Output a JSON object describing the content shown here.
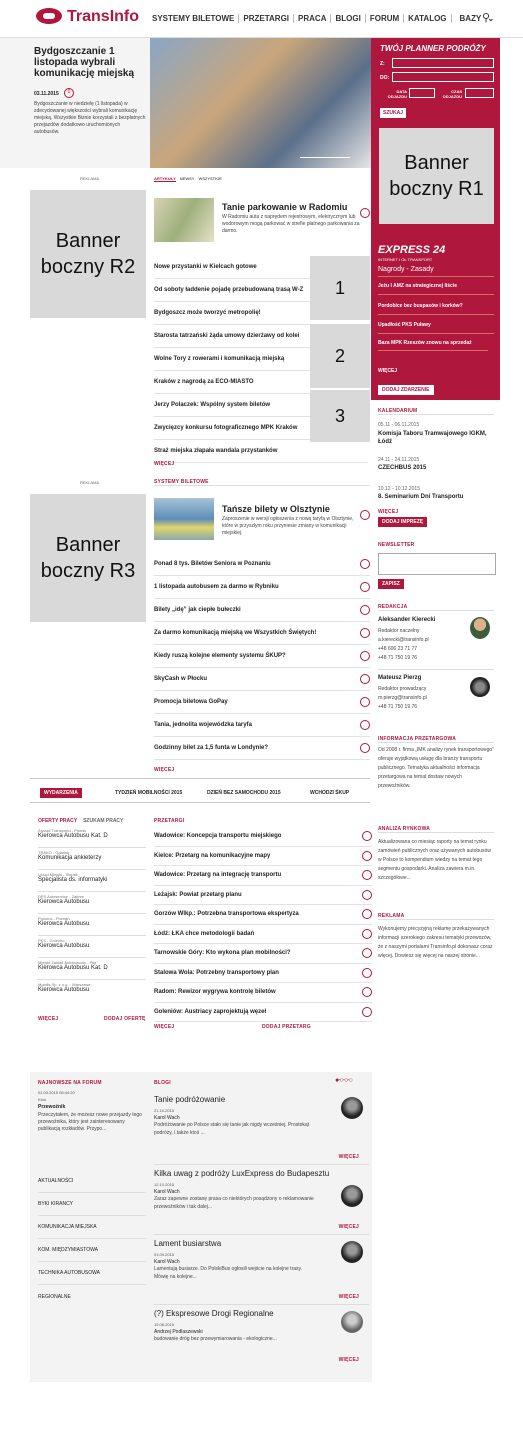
{
  "header": {
    "logo": "TransInfo",
    "nav": [
      "SYSTEMY BILETOWE",
      "PRZETARGI",
      "PRACA",
      "BLOGI",
      "FORUM",
      "KATALOG",
      "BAZY"
    ],
    "search_icon": "search-icon"
  },
  "hero": {
    "title": "Bydgoszczanie 1 listopada wybrali komunikację miejską",
    "date": "03.11.2015",
    "count": "0",
    "text": "Bydgoszczanie w niedzielę (1 listopada) w zdecydowanej większości wybrali komunikację miejską. Wszystkie Biznie korzystali z bezpłatnych przejazdów dodatkowo uruchomionych autobusów."
  },
  "planner": {
    "title": "TWÓJ PLANNER PODRÓŻY",
    "from": "Z:",
    "to": "DO:",
    "date": "DATA ODJAZDU",
    "time": "CZAS ODJAZDU",
    "button": "SZUKAJ"
  },
  "banners": {
    "r1": "Banner boczny R1",
    "r2": "Banner boczny R2",
    "r3": "Banner boczny R3",
    "ad": "REKLAMA"
  },
  "news": {
    "tabs": [
      "ARTYKUŁY",
      "NEWSY",
      "WSZYSTKIE"
    ],
    "feature_title": "Tanie parkowanie w Radomiu",
    "feature_text": "W Radomiu auta z naprędem rejestrowym, elektrycznym lub wodorowym mogą parkować w strefie płatnego parkowania za darmo.",
    "items": [
      "Nowe przystanki w Kielcach gotowe",
      "Od soboty ładdenie pojadę przebudowaną trasą W-Z",
      "Bydgoszcz może tworzyć metropolię!",
      "Starosta tatrzański żąda umowy dzierżawy od kolei",
      "Wolne Tory z rowerami i komunikacją miejską",
      "Kraków z nagrodą za ECO-MIASTO",
      "Jerzy Polaczek: Wspólny system biletów",
      "Zwycięzcy konkursu fotograficznego MPK Kraków",
      "Straż miejska złapała wandala przystanków"
    ],
    "more": "WIĘCEJ",
    "numbers": [
      "1",
      "2",
      "3"
    ]
  },
  "express": {
    "title": "EXPRESS 24",
    "sub": "INTERNET I OŁ TRANSPORT",
    "items": [
      "Nagrody - Zasady",
      "Jeżu I AMZ na strategicznej liście",
      "Pordobice bez buspasów i korków?",
      "Upadłość PKS Puławy",
      "Baza MPK Rzeszów znowu na sprzedaż"
    ],
    "more": "WIĘCEJ",
    "add": "DODAJ ZDARZENIE"
  },
  "calendar": {
    "title": "KALENDARIUM",
    "events": [
      {
        "date": "05.11 - 06.11.2015",
        "name": "Komisja Taboru Tramwajowego IGKM, Łódź"
      },
      {
        "date": "24.11 - 24.11.2015",
        "name": "CZECHBUS 2015"
      },
      {
        "date": "10.12 - 10.12.2015",
        "name": "8. Seminarium Dni Transportu"
      }
    ],
    "more": "WIĘCEJ",
    "add": "DODAJ IMPREZĘ"
  },
  "tickets": {
    "label": "SYSTEMY BILETOWE",
    "feature_title": "Tańsze bilety w Olsztynie",
    "feature_text": "Zaproszenie w wersji ogłoszenia z nową taryfą w Olsztynie, które w przyszłym roku przyniesie zmiany w komunikacji miejskiej.",
    "items": [
      "Ponad 8 tys. Biletów Seniora w Poznaniu",
      "1 listopada autobusem za darmo w Rybniku",
      "Bilety „idę” jak ciepłe bułeczki",
      "Za darmo komunikacją miejską we Wszystkich Świętych!",
      "Kiedy ruszą kolejne elementy systemu ŚKUP?",
      "SkyCash w Płocku",
      "Promocja biletowa GoPay",
      "Tania, jednolita wojewódzka taryfa",
      "Godzinny bilet za 1,5 funta w Londynie?"
    ],
    "more": "WIĘCEJ"
  },
  "newsletter": {
    "title": "NEWSLETTER",
    "button": "ZAPISZ"
  },
  "redakcja": {
    "title": "REDAKCJA",
    "people": [
      {
        "name": "Aleksander Kierecki",
        "role": "Redaktor naczelny",
        "email": "a.kierecki@transinfo.pl",
        "phone": "+48 606 23 71 77",
        "fax": "+48 71 750 19 76"
      },
      {
        "name": "Mateusz Pierzg",
        "role": "Redaktor prowadzący",
        "email": "m.pierzg@transinfo.pl",
        "phone": "+48 71 750 19 76"
      }
    ]
  },
  "info": {
    "title": "INFORMACJA PRZETARGOWA",
    "text": "Od 2008 r. firma „IMK analizy rynek transportowego” oferuje wyjątkową usługę dla branży transportu publicznego. Tematyka aktualności informacja przetargowa na temat dostaw nowych przewoźników."
  },
  "events_bar": {
    "label": "WYDARZENIA",
    "items": [
      "TYDZIEŃ MOBILNOŚCI 2015",
      "DZIEŃ BEZ SAMOCHODU 2015",
      "WCHODZI ŚKUP"
    ]
  },
  "jobs": {
    "tabs": [
      "OFERTY PRACY",
      "SZUKAM PRACY"
    ],
    "items": [
      {
        "co": "Zarząd Transportu - Płońsk",
        "title": "Kierowca Autobusu Kat. D"
      },
      {
        "co": "TRAKO - Gdańsk",
        "title": "Komunikacja ankieterzy"
      },
      {
        "co": "Urząd Miejski - Słupsk",
        "title": "Specjalista ds. informatyki"
      },
      {
        "co": "DPS Autoservice - Zabrze",
        "title": "Kierowca Autobusu"
      },
      {
        "co": "Polonus - Poznań",
        "title": "Kierowca Autobusu"
      },
      {
        "co": "PKS - Gniezno",
        "title": "Kierowca Autobusu"
      },
      {
        "co": "Miejski Zakład Autobusowy - Piła",
        "title": "Kierowca Autobusu Kat. D"
      },
      {
        "co": "Mobilis Sp. z o.o. - Warszawa",
        "title": "Kierowca Autobusu"
      }
    ],
    "more": "WIĘCEJ",
    "add": "DODAJ OFERTĘ"
  },
  "tenders": {
    "label": "PRZETARGI",
    "items": [
      "Wadowice: Koncepcja transportu miejskiego",
      "Kielce: Przetarg na komunikacyjne mapy",
      "Wadowice: Przetarg na integrację transportu",
      "Leżajsk: Powiat przetarg planu",
      "Gorzów Wlkp.: Potrzebna transportowa ekspertyza",
      "Łódź: ŁKA chce metodologii badań",
      "Tarnowskie Góry: Kto wykona plan mobilności?",
      "Stalowa Wola: Potrzebny transportowy plan",
      "Radom: Rewizor wygrywa kontrolę biletów",
      "Goleniów: Austriacy zaprojektują węzeł"
    ],
    "more": "WIĘCEJ",
    "add": "DODAJ PRZETARG"
  },
  "analysis": {
    "title": "ANALIZA RYNKOWA",
    "text": "Aktualizowana co miesiąc raporty na temat rynku zamówień publicznych oraz używanych autobusów w Polsce to kompendium wiedzy na temat tego segmentu gospodarki. Analiza zawiera m.in. szczegółowe..."
  },
  "reklama": {
    "title": "REKLAMA",
    "text": "Wykonujemy precyzyjną reklamę przekazywanych informacji szerokiego zakresu tematyki przewozów, że z naszymi portalami Transinfo.pl dokonasz coraz więcej. Dowiesz się więcej na naszej stronie..."
  },
  "forum": {
    "title": "NAJNOWSZE NA FORUM",
    "date": "02.03.2015 08:44:20",
    "user": "Ktoś",
    "topic": "Przewoźnik",
    "text": "Przeczytałem, że możesz nowe przejazdy tego przewoźnika, który jest zainteresowany publikacją rozkładów. Przypo...",
    "cats": [
      "AKTUALNOŚCI",
      "BYKI KIRANCY",
      "KOMUNIKACJA MIEJSKA",
      "KOM. MIĘDZYMIASTOWA",
      "TECHNIKA AUTOBUSOWA",
      "REGIONALNE"
    ]
  },
  "blogs": {
    "title": "BLOGI",
    "items": [
      {
        "title": "Tanie podróżowanie",
        "date": "21.10.2015",
        "author": "Karol Wach",
        "text": "Podróżowanie po Polsce stało się tanie jak nigdy wcześniej. Prostokąt podróży, i także ktoś ...",
        "more": "WIĘCEJ"
      },
      {
        "title": "Kilka uwag z podróży LuxExpress do Budapesztu",
        "date": "12.10.2015",
        "author": "Karol Wach",
        "text": "Zaraz zapewne zostanę prasa co niektórych posądzony o reklamowanie przewoźników i tak dalej...",
        "more": "WIĘCEJ"
      },
      {
        "title": "Lament busiarstwa",
        "date": "01.09.2015",
        "author": "Karol Wach",
        "text": "Lamentują busiarze. Do PolskiBus ogłosili wejście na kolejne trasy. Mówię na kolejne...",
        "more": "WIĘCEJ"
      },
      {
        "title": "(?) Ekspresowe Drogi Regionalne",
        "date": "19.08.2015",
        "author": "Andrzej Podlaszewski",
        "text": "budowanie dróg bez przewymiarowania - ekologiczne...",
        "more": "WIĘCEJ"
      }
    ]
  },
  "colors": {
    "accent": "#b0173d"
  }
}
